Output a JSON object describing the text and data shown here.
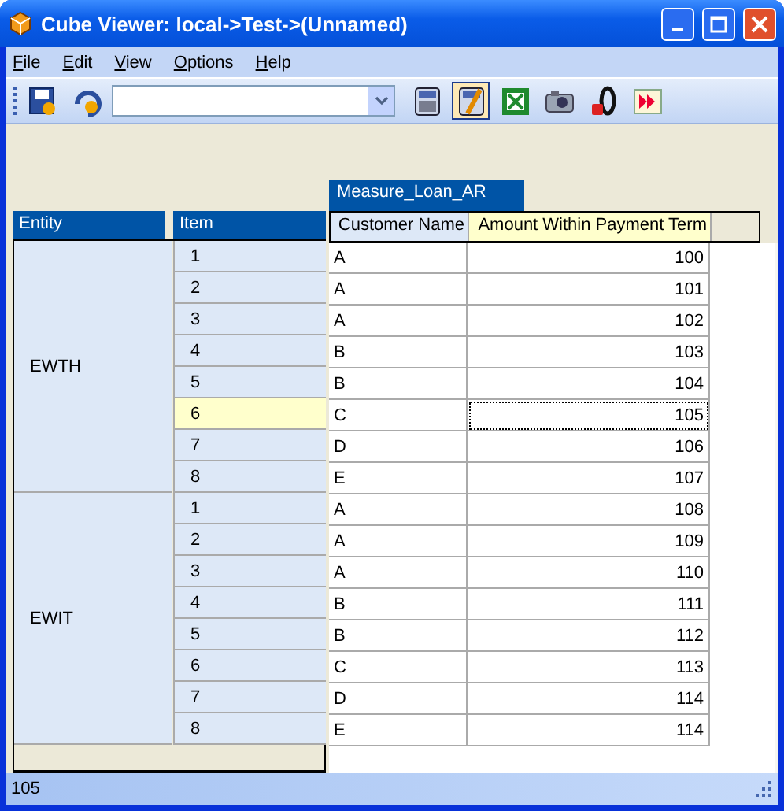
{
  "window": {
    "title": "Cube Viewer: local->Test->(Unnamed)"
  },
  "menu": [
    "File",
    "Edit",
    "View",
    "Options",
    "Help"
  ],
  "toolbar": {
    "left_buttons": [
      {
        "kind": "save",
        "selected": false
      },
      {
        "kind": "recalc",
        "selected": false
      }
    ],
    "right_buttons": [
      {
        "kind": "calculator",
        "selected": false
      },
      {
        "kind": "calculator-pencil",
        "selected": true
      },
      {
        "kind": "excel",
        "selected": false
      },
      {
        "kind": "camera",
        "selected": false
      },
      {
        "kind": "zero",
        "selected": false
      },
      {
        "kind": "forward",
        "selected": false
      }
    ]
  },
  "grid": {
    "measure_tab": "Measure_Loan_AR",
    "row_headers": [
      "Entity",
      "Item"
    ],
    "columns": [
      "Customer Name",
      "Amount Within Payment Term"
    ],
    "groups": [
      {
        "entity": "EWTH",
        "rows": [
          {
            "item": "1",
            "customer": "A",
            "amount": "100",
            "selected": false
          },
          {
            "item": "2",
            "customer": "A",
            "amount": "101",
            "selected": false
          },
          {
            "item": "3",
            "customer": "A",
            "amount": "102",
            "selected": false
          },
          {
            "item": "4",
            "customer": "B",
            "amount": "103",
            "selected": false
          },
          {
            "item": "5",
            "customer": "B",
            "amount": "104",
            "selected": false
          },
          {
            "item": "6",
            "customer": "C",
            "amount": "105",
            "selected": true
          },
          {
            "item": "7",
            "customer": "D",
            "amount": "106",
            "selected": false
          },
          {
            "item": "8",
            "customer": "E",
            "amount": "107",
            "selected": false
          }
        ]
      },
      {
        "entity": "EWIT",
        "rows": [
          {
            "item": "1",
            "customer": "A",
            "amount": "108",
            "selected": false
          },
          {
            "item": "2",
            "customer": "A",
            "amount": "109",
            "selected": false
          },
          {
            "item": "3",
            "customer": "A",
            "amount": "110",
            "selected": false
          },
          {
            "item": "4",
            "customer": "B",
            "amount": "111",
            "selected": false
          },
          {
            "item": "5",
            "customer": "B",
            "amount": "112",
            "selected": false
          },
          {
            "item": "6",
            "customer": "C",
            "amount": "113",
            "selected": false
          },
          {
            "item": "7",
            "customer": "D",
            "amount": "114",
            "selected": false
          },
          {
            "item": "8",
            "customer": "E",
            "amount": "114",
            "selected": false
          }
        ]
      }
    ]
  },
  "status_bar": "105"
}
